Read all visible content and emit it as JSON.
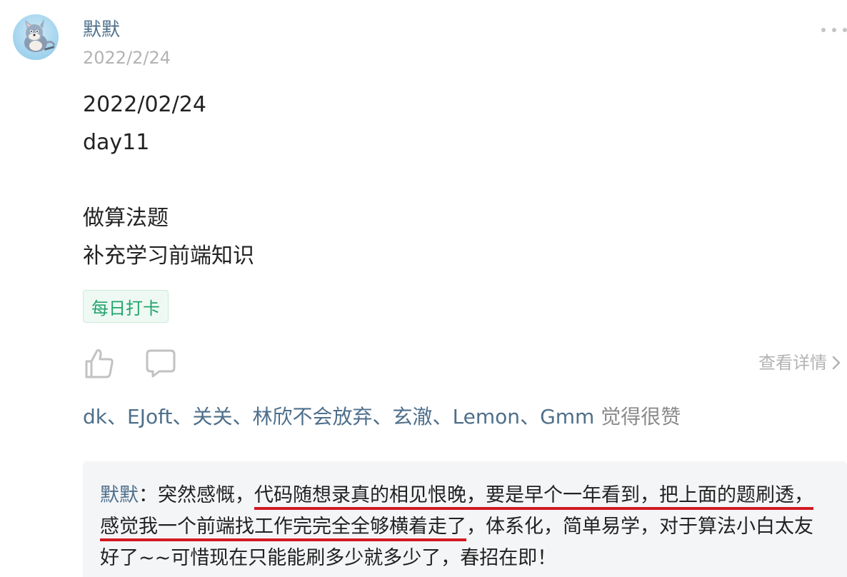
{
  "post": {
    "author": "默默",
    "date": "2022/2/24",
    "more_icon": "more-dots-icon",
    "content_lines": [
      "2022/02/24",
      "day11",
      "",
      "做算法题",
      "补充学习前端知识"
    ],
    "tag": "每日打卡"
  },
  "actions": {
    "like_icon": "thumbs-up-icon",
    "comment_icon": "comment-bubble-icon",
    "detail_label": "查看详情"
  },
  "likes": {
    "names": [
      "dk",
      "EJoft",
      "关关",
      "林欣不会放弃",
      "玄澈",
      "Lemon",
      "Gmm"
    ],
    "separator": "、",
    "suffix": " 觉得很赞"
  },
  "comment": {
    "author": "默默",
    "colon": "：",
    "segments": [
      {
        "text": "突然感慨，",
        "highlight": false
      },
      {
        "text": "代码随想录真的相见恨晚，要是早个一年看到，把上面的题刷透，感觉我一个前端找工作完完全全够横着走了",
        "highlight": true
      },
      {
        "text": "，体系化，简单易学，对于算法小白太友好了~~可惜现在只能能刷多少就多少了，春招在即！",
        "highlight": false
      }
    ],
    "highlight_color": "#d11a22"
  },
  "colors": {
    "link": "#4e6f8b",
    "muted": "#b3b3b3",
    "tag_green": "#22a46b",
    "comment_bg": "#f4f5f7"
  }
}
